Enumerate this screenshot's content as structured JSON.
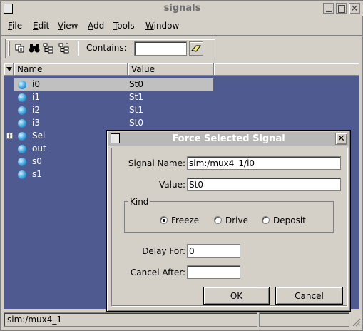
{
  "window": {
    "title": "signals"
  },
  "menu": [
    {
      "label": "File",
      "mnemonic": "F",
      "rest": "ile"
    },
    {
      "label": "Edit",
      "mnemonic": "E",
      "rest": "dit"
    },
    {
      "label": "View",
      "mnemonic": "V",
      "rest": "iew"
    },
    {
      "label": "Add",
      "mnemonic": "A",
      "rest": "dd"
    },
    {
      "label": "Tools",
      "mnemonic": "T",
      "rest": "ools"
    },
    {
      "label": "Window",
      "mnemonic": "W",
      "rest": "indow"
    }
  ],
  "toolbar": {
    "contains_label": "Contains:",
    "contains_value": ""
  },
  "columns": {
    "name": "Name",
    "value": "Value"
  },
  "signals": [
    {
      "name": "i0",
      "value": "St0",
      "selected": true
    },
    {
      "name": "i1",
      "value": "St1"
    },
    {
      "name": "i2",
      "value": "St1"
    },
    {
      "name": "i3",
      "value": "St0"
    },
    {
      "name": "Sel",
      "value": "",
      "expandable": true
    },
    {
      "name": "out",
      "value": ""
    },
    {
      "name": "s0",
      "value": ""
    },
    {
      "name": "s1",
      "value": ""
    }
  ],
  "status": {
    "path": "sim:/mux4_1"
  },
  "dialog": {
    "title": "Force Selected Signal",
    "signal_name_label": "Signal Name:",
    "signal_name_value": "sim:/mux4_1/i0",
    "value_label": "Value:",
    "value_value": "St0",
    "kind_label": "Kind",
    "kinds": [
      "Freeze",
      "Drive",
      "Deposit"
    ],
    "kind_selected": "Freeze",
    "delay_label": "Delay For:",
    "delay_value": "0",
    "cancel_after_label": "Cancel After:",
    "cancel_after_value": "",
    "ok_label": "OK",
    "cancel_label": "Cancel"
  }
}
